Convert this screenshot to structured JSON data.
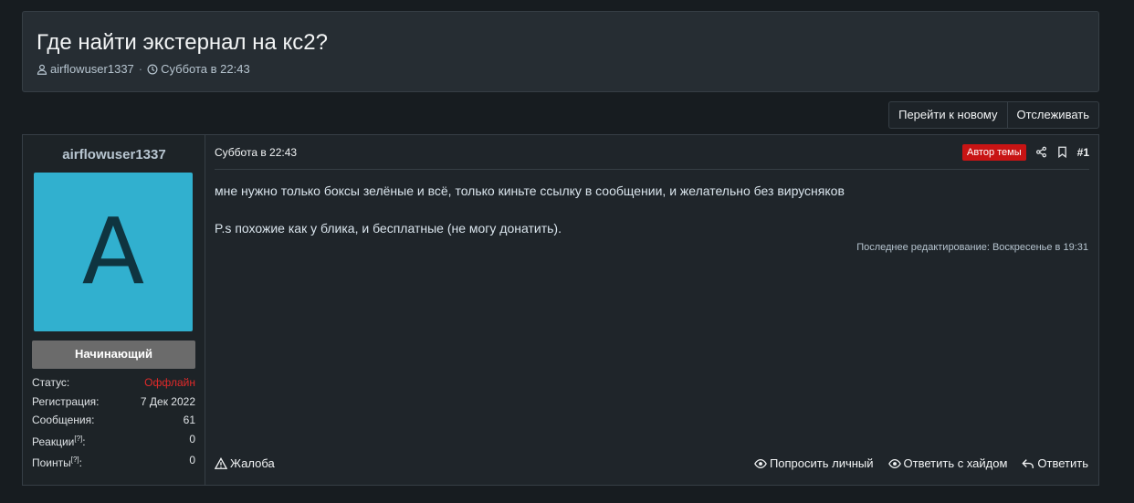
{
  "thread": {
    "title": "Где найти экстернал на кс2?",
    "author": "airflowuser1337",
    "date": "Суббота в 22:43"
  },
  "actions": {
    "go_new": "Перейти к новому",
    "watch": "Отслеживать"
  },
  "user": {
    "name": "airflowuser1337",
    "avatar_letter": "A",
    "avatar_color": "#31b0cf",
    "rank": "Начинающий",
    "stats": [
      {
        "label": "Статус:",
        "value": "Оффлайн"
      },
      {
        "label": "Регистрация:",
        "value": "7 Дек 2022"
      },
      {
        "label": "Сообщения:",
        "value": "61"
      },
      {
        "label": "Реакции",
        "sup": "[?]",
        "suffix": ":",
        "value": "0"
      },
      {
        "label": "Поинты",
        "sup": "[?]",
        "suffix": ":",
        "value": "0"
      }
    ]
  },
  "post": {
    "date": "Суббота в 22:43",
    "author_badge": "Автор темы",
    "number": "#1",
    "paragraphs": [
      "мне нужно только боксы зелёные и всё, только киньте ссылку в сообщении, и желательно без вирусняков",
      "P.s похожие как у блика, и бесплатные (не могу донатить)."
    ],
    "edited": "Последнее редактирование: Воскресенье в 19:31",
    "report": "Жалоба",
    "ask_private": "Попросить личный",
    "reply_hide": "Ответить с хайдом",
    "reply": "Ответить"
  },
  "icons": [
    "user-icon",
    "clock-icon",
    "share-icon",
    "bookmark-icon",
    "warning-icon",
    "eye-icon",
    "reply-icon"
  ],
  "colors": {
    "offline": "#e02a2a",
    "badge": "#c81414"
  }
}
